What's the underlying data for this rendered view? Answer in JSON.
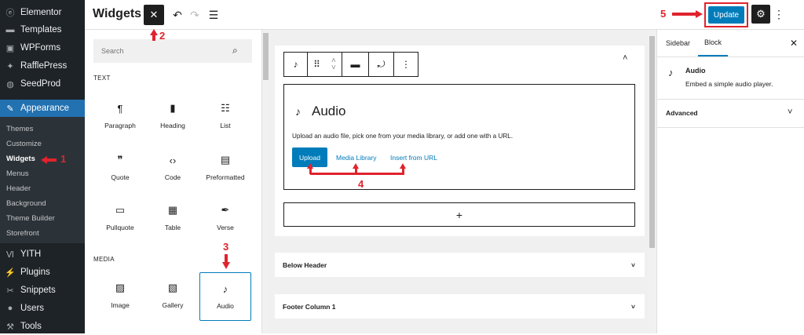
{
  "admin_menu": {
    "items": [
      {
        "label": "Elementor",
        "icon": "elementor-icon",
        "glyph": "ⓔ"
      },
      {
        "label": "Templates",
        "icon": "folder-icon",
        "glyph": "▬"
      },
      {
        "label": "WPForms",
        "icon": "wpforms-icon",
        "glyph": "▣"
      },
      {
        "label": "RafflePress",
        "icon": "gift-icon",
        "glyph": "✦"
      },
      {
        "label": "SeedProd",
        "icon": "seedprod-icon",
        "glyph": "◍"
      },
      {
        "label": "Appearance",
        "icon": "paintbrush-icon",
        "glyph": "✎"
      }
    ],
    "submenu": [
      "Themes",
      "Customize",
      "Widgets",
      "Menus",
      "Header",
      "Background",
      "Theme Builder",
      "Storefront"
    ],
    "current_submenu": "Widgets",
    "bottom_items": [
      {
        "label": "YITH",
        "icon": "yith-icon",
        "glyph": "Ⅵ"
      },
      {
        "label": "Plugins",
        "icon": "plug-icon",
        "glyph": "⚡"
      },
      {
        "label": "Snippets",
        "icon": "scissors-icon",
        "glyph": "✂"
      },
      {
        "label": "Users",
        "icon": "user-icon",
        "glyph": "●"
      },
      {
        "label": "Tools",
        "icon": "wrench-icon",
        "glyph": "⚒"
      }
    ]
  },
  "header": {
    "title": "Widgets",
    "close_glyph": "✕",
    "undo_glyph": "↶",
    "redo_glyph": "↷",
    "list_glyph": "☰",
    "update_label": "Update",
    "settings_glyph": "⚙",
    "more_glyph": "⋮"
  },
  "inserter": {
    "search_placeholder": "Search",
    "search_glyph": "⌕",
    "categories": [
      {
        "name": "TEXT",
        "blocks": [
          {
            "label": "Paragraph",
            "icon": "paragraph-icon",
            "glyph": "¶"
          },
          {
            "label": "Heading",
            "icon": "bookmark-icon",
            "glyph": "▮"
          },
          {
            "label": "List",
            "icon": "list-icon",
            "glyph": "☷"
          },
          {
            "label": "Quote",
            "icon": "quote-icon",
            "glyph": "❞"
          },
          {
            "label": "Code",
            "icon": "code-icon",
            "glyph": "‹›"
          },
          {
            "label": "Preformatted",
            "icon": "preformatted-icon",
            "glyph": "▤"
          },
          {
            "label": "Pullquote",
            "icon": "pullquote-icon",
            "glyph": "▭"
          },
          {
            "label": "Table",
            "icon": "table-icon",
            "glyph": "▦"
          },
          {
            "label": "Verse",
            "icon": "feather-icon",
            "glyph": "✒"
          }
        ]
      },
      {
        "name": "MEDIA",
        "blocks": [
          {
            "label": "Image",
            "icon": "image-icon",
            "glyph": "▨"
          },
          {
            "label": "Gallery",
            "icon": "gallery-icon",
            "glyph": "▧"
          },
          {
            "label": "Audio",
            "icon": "music-note-icon",
            "glyph": "♪"
          }
        ]
      }
    ],
    "selected_block": "Audio"
  },
  "editor": {
    "toolbar": {
      "note_glyph": "♪",
      "drag_glyph": "⠿",
      "move_up": "˄",
      "move_down": "˅",
      "align_glyph": "▬",
      "transform_glyph": "⤾",
      "more_glyph": "⋮"
    },
    "collapse_glyph": "˄",
    "audio_block": {
      "glyph": "♪",
      "title": "Audio",
      "instructions": "Upload an audio file, pick one from your media library, or add one with a URL.",
      "upload_label": "Upload",
      "media_library_label": "Media Library",
      "insert_url_label": "Insert from URL"
    },
    "add_block_glyph": "+",
    "areas": [
      {
        "label": "Below Header",
        "glyph": "˅"
      },
      {
        "label": "Footer Column 1",
        "glyph": "˅"
      }
    ]
  },
  "settings_sidebar": {
    "tabs": [
      "Sidebar",
      "Block"
    ],
    "active_tab": "Block",
    "close_glyph": "✕",
    "block_glyph": "♪",
    "block_name": "Audio",
    "block_description": "Embed a simple audio player.",
    "advanced_label": "Advanced",
    "advanced_glyph": "˅"
  },
  "annotations": {
    "step1": "1",
    "step2": "2",
    "step3": "3",
    "step4": "4",
    "step5": "5",
    "color": "#e0232d"
  },
  "colors": {
    "accent": "#007cba",
    "admin_bg": "#1d2327",
    "admin_active": "#2271b1"
  }
}
